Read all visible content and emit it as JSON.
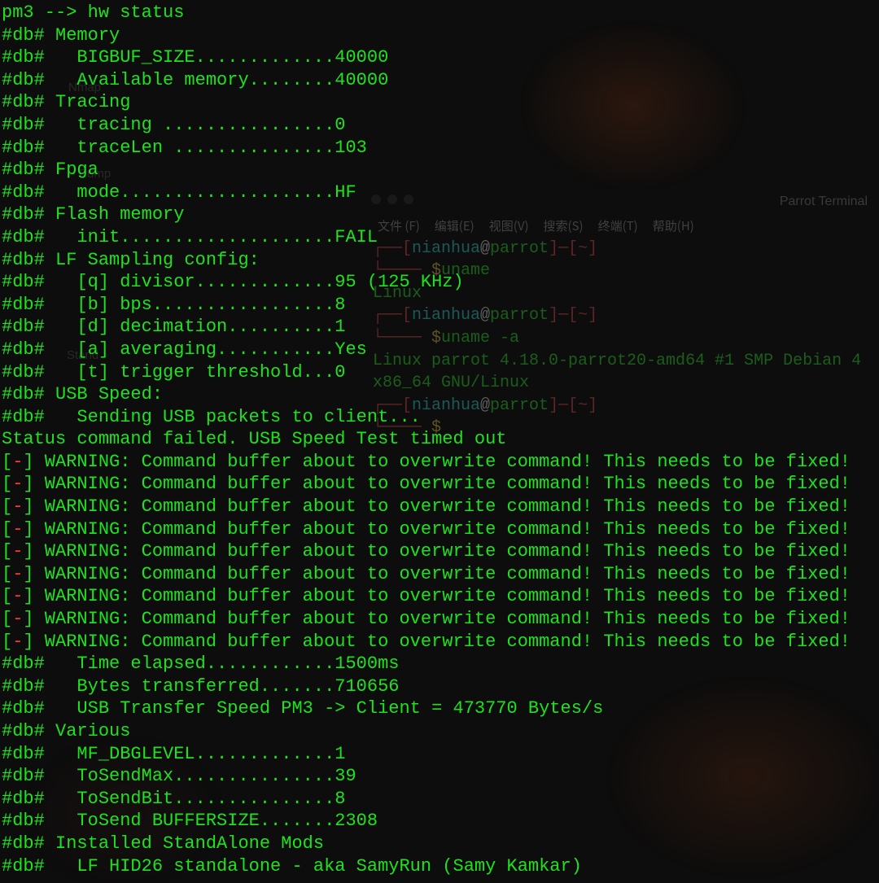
{
  "desktop": {
    "labels": [
      "Nmap",
      "Pump",
      "Stand"
    ]
  },
  "bg_window": {
    "title": "Parrot Terminal",
    "menu": [
      "文件 (F)",
      "编辑(E)",
      "视图(V)",
      "搜索(S)",
      "终端(T)",
      "帮助(H)"
    ],
    "prompt_user": "nianhua",
    "prompt_at": "@",
    "prompt_host": "parrot",
    "prompt_tail": "]─[~]",
    "lines": [
      {
        "type": "prompt"
      },
      {
        "type": "cmd",
        "arrow": "──── ",
        "dollar": "$",
        "cmd": "uname"
      },
      {
        "type": "out",
        "text": "Linux"
      },
      {
        "type": "prompt"
      },
      {
        "type": "cmd",
        "arrow": "──── ",
        "dollar": "$",
        "cmd": "uname -a"
      },
      {
        "type": "out",
        "text": "Linux parrot 4.18.0-parrot20-amd64 #1 SMP Debian 4"
      },
      {
        "type": "out",
        "text": "x86_64 GNU/Linux"
      },
      {
        "type": "prompt"
      },
      {
        "type": "cmd",
        "arrow": "──── ",
        "dollar": "$",
        "cmd": ""
      }
    ]
  },
  "fg_term": {
    "prompt": "pm3 --> ",
    "command": "hw status",
    "db_prefix": "#db#",
    "warn_bracket_open": "[",
    "warn_dash": "-",
    "warn_bracket_close": "]",
    "warn_msg": "WARNING: Command buffer about to overwrite command! This needs to be fixed!",
    "warn_count": 9,
    "status_fail": "Status command failed. USB Speed Test timed out",
    "lines": [
      " Memory",
      "   BIGBUF_SIZE.............40000",
      "   Available memory........40000",
      " Tracing",
      "   tracing ................0",
      "   traceLen ...............103",
      " Fpga",
      "   mode....................HF",
      " Flash memory",
      "   init....................FAIL",
      " LF Sampling config:",
      "   [q] divisor.............95 (125 KHz)",
      "   [b] bps.................8",
      "   [d] decimation..........1",
      "   [a] averaging...........Yes",
      "   [t] trigger threshold...0",
      " USB Speed:",
      "   Sending USB packets to client..."
    ],
    "tail_lines": [
      "   Time elapsed............1500ms",
      "   Bytes transferred.......710656",
      "   USB Transfer Speed PM3 -> Client = 473770 Bytes/s",
      " Various",
      "   MF_DBGLEVEL.............1",
      "   ToSendMax...............39",
      "   ToSendBit...............8",
      "   ToSend BUFFERSIZE.......2308",
      " Installed StandAlone Mods",
      "   LF HID26 standalone - aka SamyRun (Samy Kamkar)"
    ]
  }
}
